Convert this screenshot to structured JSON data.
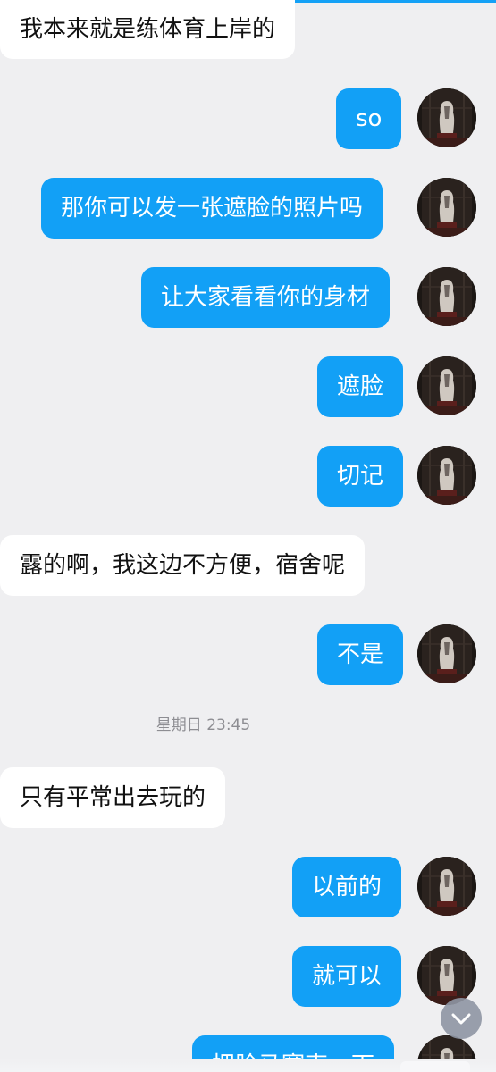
{
  "theme": {
    "outgoing_bubble": "#12a0f6",
    "incoming_bubble": "#ffffff",
    "background": "#efeff1",
    "accent": "#14a1f6"
  },
  "chat": {
    "messages": [
      {
        "direction": "incoming",
        "text": "我本来就是练体育上岸的"
      },
      {
        "direction": "outgoing",
        "text": "so"
      },
      {
        "direction": "outgoing",
        "text": "那你可以发一张遮脸的照片吗"
      },
      {
        "direction": "outgoing",
        "text": "让大家看看你的身材"
      },
      {
        "direction": "outgoing",
        "text": "遮脸"
      },
      {
        "direction": "outgoing",
        "text": "切记"
      },
      {
        "direction": "incoming",
        "text": "露的啊，我这边不方便，宿舍呢"
      },
      {
        "direction": "outgoing",
        "text": "不是"
      },
      {
        "direction": "timestamp",
        "text": "星期日 23:45"
      },
      {
        "direction": "incoming",
        "text": "只有平常出去玩的"
      },
      {
        "direction": "outgoing",
        "text": "以前的"
      },
      {
        "direction": "outgoing",
        "text": "就可以"
      },
      {
        "direction": "outgoing",
        "text": "把脸马赛克一下"
      }
    ]
  },
  "controls": {
    "scroll_to_bottom_icon": "chevron-down-icon"
  }
}
